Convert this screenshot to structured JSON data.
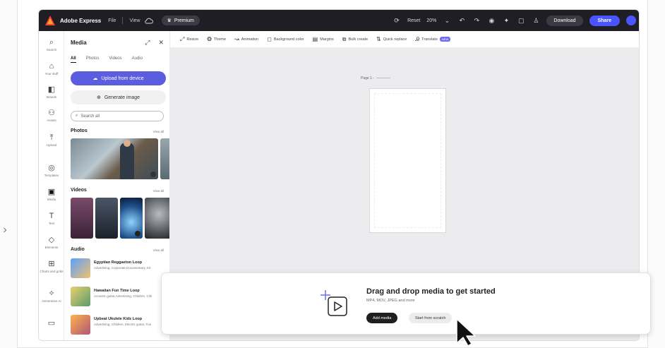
{
  "nav": {
    "chevron": "›"
  },
  "topbar": {
    "brand": "Adobe Express",
    "file": "File",
    "view": "View",
    "premium": "Premium",
    "reset": "Reset",
    "zoom": "20%",
    "download": "Download",
    "share": "Share"
  },
  "rail": {
    "items": [
      {
        "icon": "⌕",
        "label": "Search"
      },
      {
        "icon": "⌂",
        "label": "Your stuff"
      },
      {
        "icon": "◧",
        "label": "Brands"
      },
      {
        "icon": "⚇",
        "label": "Assets"
      },
      {
        "icon": "⤒",
        "label": "Upload"
      },
      {
        "icon": "◎",
        "label": "Templates"
      },
      {
        "icon": "▣",
        "label": "Media"
      },
      {
        "icon": "T",
        "label": "Text"
      },
      {
        "icon": "◇",
        "label": "Elements"
      },
      {
        "icon": "⊞",
        "label": "Charts and grids"
      },
      {
        "icon": "✧",
        "label": "Generative AI"
      },
      {
        "icon": "▭",
        "label": ""
      }
    ]
  },
  "panel": {
    "title": "Media",
    "tabs": [
      "All",
      "Photos",
      "Videos",
      "Audio"
    ],
    "upload_label": "Upload from device",
    "generate_label": "Generate image",
    "search_placeholder": "Search all",
    "photos_title": "Photos",
    "videos_title": "Videos",
    "audio_title": "Audio",
    "view_all": "View all",
    "audio": [
      {
        "title": "Egyptian Reggaeton Loop",
        "sub": "Advertising, Corporate,Documentary, Kit"
      },
      {
        "title": "Hawaiian Fun Time Loop",
        "sub": "Acoustic guitar,Advertising, Children, Clik"
      },
      {
        "title": "Upbeat Ukulele Kids Loop",
        "sub": "Advertising, Children, Electric guitar, Fun"
      }
    ]
  },
  "toolbar": {
    "items": [
      {
        "icon": "⤢",
        "label": "Resize"
      },
      {
        "icon": "❂",
        "label": "Theme"
      },
      {
        "icon": "↝",
        "label": "Animation"
      },
      {
        "icon": "◻",
        "label": "Background color"
      },
      {
        "icon": "▤",
        "label": "Margins"
      },
      {
        "icon": "⧉",
        "label": "Bulk create"
      },
      {
        "icon": "⇅",
        "label": "Quick replace"
      },
      {
        "icon": "Ꭿ",
        "label": "Translate"
      }
    ],
    "new_badge": "NEW"
  },
  "canvas": {
    "page_label": "Page 1 -"
  },
  "drop": {
    "title": "Drag and drop media to get started",
    "sub": "MP4, MOV, JPEG and more",
    "add_media": "Add media",
    "start_scratch": "Start from scratch"
  },
  "colors": {
    "accent": "#5c5ce0",
    "share": "#4b55ff",
    "dark": "#1e1e24"
  }
}
